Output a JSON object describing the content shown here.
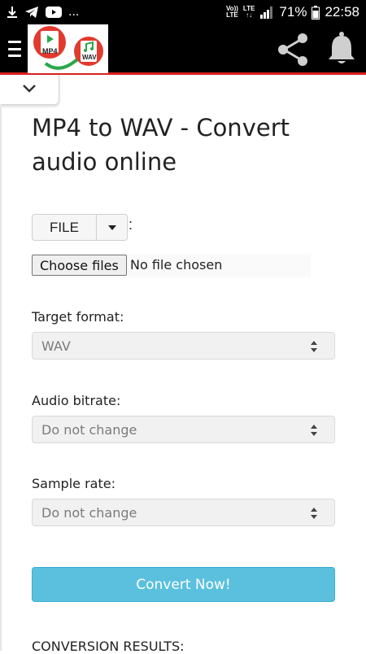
{
  "status_bar": {
    "notification_icons": [
      "download-icon",
      "telegram-icon",
      "youtube-icon"
    ],
    "more": "...",
    "volte_top": "Vo))",
    "volte_bottom": "LTE",
    "lte_top": "LTE",
    "lte_bottom": "↑↓",
    "battery_percent": "71%",
    "time": "22:58"
  },
  "app_bar": {
    "logo_left": "MP4",
    "logo_right": "WAV",
    "share_icon": "share-icon",
    "bell_icon": "bell-icon",
    "menu_icon": "hamburger-icon"
  },
  "page": {
    "title": "MP4 to WAV - Convert audio online",
    "file_button": "FILE",
    "colon": ":",
    "choose_files": "Choose files",
    "file_status": "No file chosen",
    "target_format_label": "Target format:",
    "target_format_value": "WAV",
    "audio_bitrate_label": "Audio bitrate:",
    "audio_bitrate_value": "Do not change",
    "sample_rate_label": "Sample rate:",
    "sample_rate_value": "Do not change",
    "convert_button": "Convert Now!",
    "results_heading": "CONVERSION RESULTS:"
  },
  "colors": {
    "accent": "#5bc0de",
    "app_bar": "#000000",
    "app_bar_border": "#d9201f"
  }
}
